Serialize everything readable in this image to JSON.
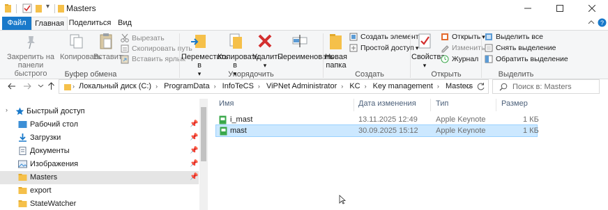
{
  "window": {
    "title": "Masters",
    "quick_access_dropdown": "▾"
  },
  "ribbon_tabs": {
    "file": "Файл",
    "home": "Главная",
    "share": "Поделиться",
    "view": "Вид"
  },
  "ribbon": {
    "clipboard": {
      "group_label": "Буфер обмена",
      "pin_quick_access": "Закрепить на панели быстрого доступа",
      "copy": "Копировать",
      "paste": "Вставить",
      "cut": "Вырезать",
      "copy_path": "Скопировать путь",
      "paste_shortcut": "Вставить ярлык"
    },
    "organize": {
      "group_label": "Упорядочить",
      "move_to": "Переместить в",
      "copy_to": "Копировать в",
      "delete": "Удалить",
      "rename": "Переименовать"
    },
    "new": {
      "group_label": "Создать",
      "new_folder": "Новая папка",
      "new_item": "Создать элемент",
      "easy_access": "Простой доступ"
    },
    "open": {
      "group_label": "Открыть",
      "properties": "Свойства",
      "open": "Открыть",
      "edit": "Изменить",
      "history": "Журнал"
    },
    "select": {
      "group_label": "Выделить",
      "select_all": "Выделить все",
      "select_none": "Снять выделение",
      "invert_selection": "Обратить выделение"
    }
  },
  "address_bar": {
    "crumbs": [
      "Локальный диск (C:)",
      "ProgramData",
      "InfoTeCS",
      "ViPNet Administrator",
      "KC",
      "Key management",
      "Masters"
    ],
    "search_placeholder": "Поиск в: Masters"
  },
  "nav_pane": {
    "quick_access": "Быстрый доступ",
    "items": [
      {
        "label": "Рабочий стол",
        "pinned": true
      },
      {
        "label": "Загрузки",
        "pinned": true
      },
      {
        "label": "Документы",
        "pinned": true
      },
      {
        "label": "Изображения",
        "pinned": true
      },
      {
        "label": "Masters",
        "pinned": true
      },
      {
        "label": "export",
        "pinned": false
      },
      {
        "label": "StateWatcher",
        "pinned": false
      }
    ]
  },
  "file_list": {
    "columns": {
      "name": "Имя",
      "date": "Дата изменения",
      "type": "Тип",
      "size": "Размер"
    },
    "rows": [
      {
        "name": "i_mast",
        "date": "13.11.2025 12:49",
        "type": "Apple Keynote",
        "size": "1 КБ"
      },
      {
        "name": "mast",
        "date": "30.09.2025 15:12",
        "type": "Apple Keynote",
        "size": "1 КБ"
      }
    ]
  },
  "colors": {
    "accent": "#1979ca",
    "selection": "#cce8ff",
    "folder": "#f5c04a",
    "delete_red": "#d32f2f",
    "keynote_green": "#3aa84b"
  }
}
